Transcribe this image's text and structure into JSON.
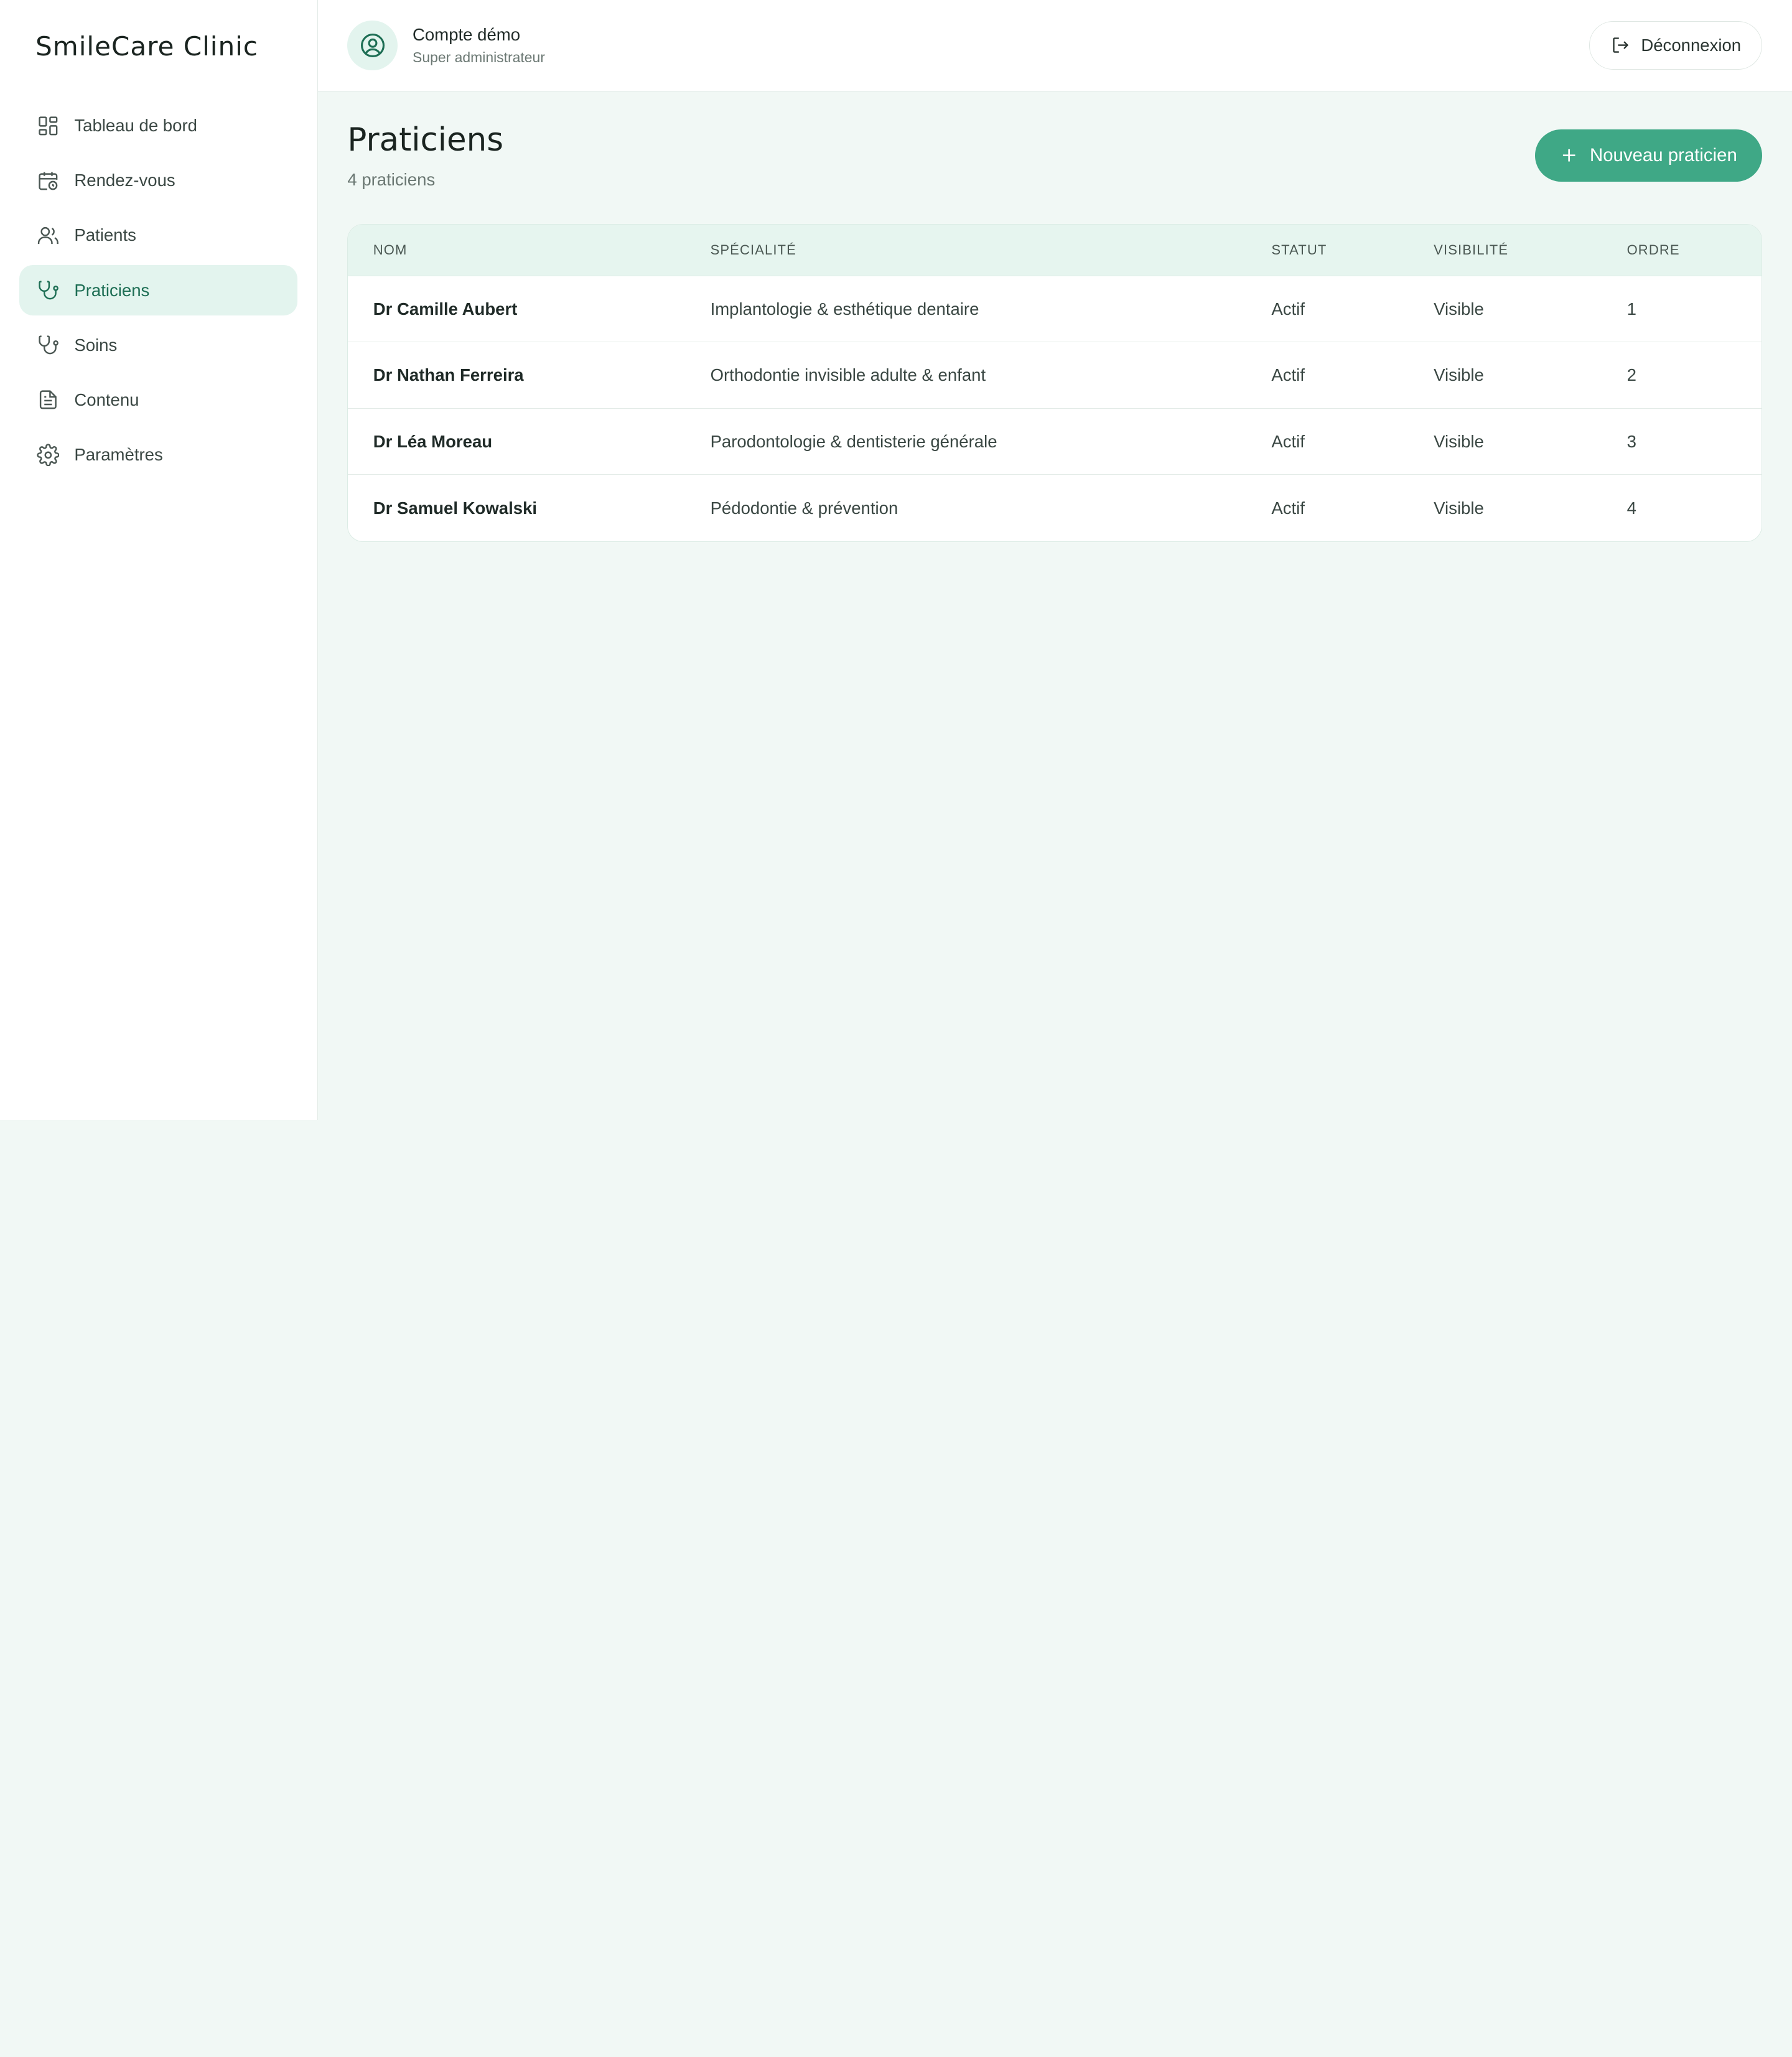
{
  "brand": "SmileCare Clinic",
  "sidebar": {
    "items": [
      {
        "label": "Tableau de bord",
        "icon": "dashboard-icon"
      },
      {
        "label": "Rendez-vous",
        "icon": "calendar-clock-icon"
      },
      {
        "label": "Patients",
        "icon": "users-icon"
      },
      {
        "label": "Praticiens",
        "icon": "stethoscope-icon",
        "active": true
      },
      {
        "label": "Soins",
        "icon": "stethoscope-icon"
      },
      {
        "label": "Contenu",
        "icon": "document-icon"
      },
      {
        "label": "Paramètres",
        "icon": "gear-icon"
      }
    ]
  },
  "header": {
    "account_name": "Compte démo",
    "account_role": "Super administrateur",
    "logout_label": "Déconnexion"
  },
  "page": {
    "title": "Praticiens",
    "subtitle": "4 praticiens",
    "new_button": "Nouveau praticien"
  },
  "table": {
    "columns": [
      "Nom",
      "Spécialité",
      "Statut",
      "Visibilité",
      "Ordre"
    ],
    "rows": [
      {
        "name": "Dr Camille Aubert",
        "specialty": "Implantologie & esthétique dentaire",
        "status": "Actif",
        "visibility": "Visible",
        "order": "1"
      },
      {
        "name": "Dr Nathan Ferreira",
        "specialty": "Orthodontie invisible adulte & enfant",
        "status": "Actif",
        "visibility": "Visible",
        "order": "2"
      },
      {
        "name": "Dr Léa Moreau",
        "specialty": "Parodontologie & dentisterie générale",
        "status": "Actif",
        "visibility": "Visible",
        "order": "3"
      },
      {
        "name": "Dr Samuel Kowalski",
        "specialty": "Pédodontie & prévention",
        "status": "Actif",
        "visibility": "Visible",
        "order": "4"
      }
    ]
  },
  "colors": {
    "accent": "#3fa886",
    "active_bg": "#e3f4ee",
    "active_text": "#1d6e54",
    "page_bg": "#f1f8f5"
  }
}
